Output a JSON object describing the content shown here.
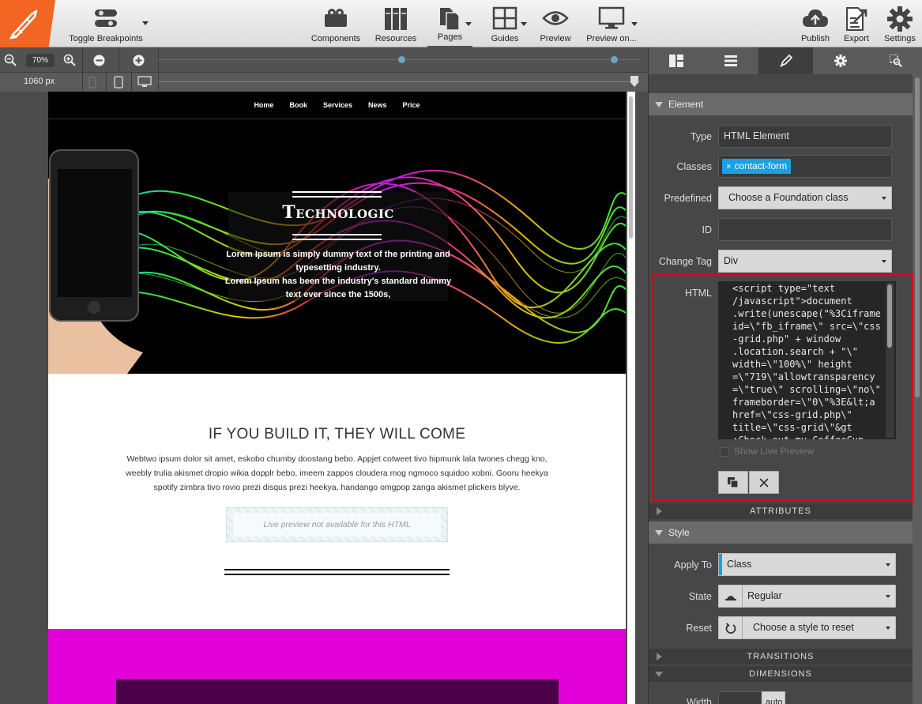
{
  "toolbar": {
    "toggle_breakpoints": "Toggle Breakpoints",
    "components": "Components",
    "resources": "Resources",
    "pages": "Pages",
    "guides": "Guides",
    "preview": "Preview",
    "preview_on": "Preview on...",
    "publish": "Publish",
    "export": "Export",
    "settings": "Settings"
  },
  "zoom": {
    "value": "70%"
  },
  "breakpoint": {
    "width": "1060 px"
  },
  "page": {
    "nav": [
      "Home",
      "Book",
      "Services",
      "News",
      "Price"
    ],
    "hero_title": "Technologic",
    "hero_text_1": "Lorem Ipsum is simply dummy text of the printing and typesetting industry.",
    "hero_text_2": "Lorem Ipsum has been the industry's standard dummy text ever since the 1500s,",
    "headline": "IF YOU BUILD IT, THEY WILL COME",
    "body": "Webtwo ipsum dolor sit amet, eskobo chumby doostang bebo. Appjet cotweet tivo hipmunk lala twones chegg kno, weebly trulia akismet dropio wikia dopplr bebo, imeem zappos cloudera mog ngmoco squidoo xobni. Gooru heekya spotify zimbra tivo rovio prezi disqus prezi heekya, handango omgpop zanga akismet plickers blyve.",
    "live_preview": "Live preview not available for this HTML"
  },
  "panel": {
    "element_section": "Element",
    "type_label": "Type",
    "type_value": "HTML Element",
    "classes_label": "Classes",
    "class_tag": "contact-form",
    "predefined_label": "Predefined",
    "predefined_value": "Choose a Foundation class",
    "id_label": "ID",
    "id_value": "",
    "change_tag_label": "Change Tag",
    "change_tag_value": "Div",
    "html_label": "HTML",
    "html_code": "<script type=\"text\n/javascript\">document\n.write(unescape(\"%3Ciframe\nid=\\\"fb_iframe\\\" src=\\\"css\n-grid.php\" + window\n.location.search + \"\\\"\nwidth=\\\"100%\\\" height\n=\\\"719\\\"allowtransparency\n=\\\"true\\\" scrolling=\\\"no\\\"\nframeborder=\\\"0\\\"%3E&lt;a\nhref=\\\"css-grid.php\\\"\ntitle=\\\"css-grid\\\"&gt\n;Check out my CoffeeCup",
    "show_live_preview": "Show Live Preview",
    "attributes": "ATTRIBUTES",
    "style_section": "Style",
    "apply_to_label": "Apply To",
    "apply_to_value": "Class",
    "state_label": "State",
    "state_value": "Regular",
    "reset_label": "Reset",
    "reset_value": "Choose a style to reset",
    "transitions": "TRANSITIONS",
    "dimensions": "DIMENSIONS",
    "width_label": "Width",
    "width_unit": "auto"
  },
  "colors": {
    "logo": "#f26522",
    "accent_blue": "#1aa0e6",
    "highlight_red": "#e0001b",
    "magenta": "#e100d8"
  }
}
